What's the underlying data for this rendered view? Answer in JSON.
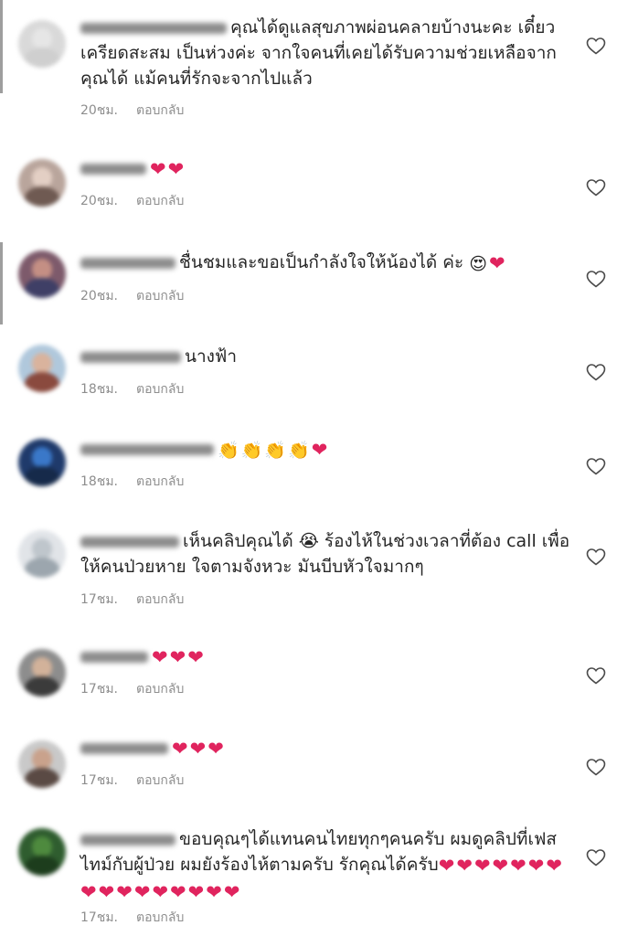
{
  "comments": [
    {
      "text": "คุณได้ดูแลสุขภาพผ่อนคลายบ้างนะคะ เดี๋ยวเครียดสะสม เป็นห่วงค่ะ จากใจคนที่เคยได้รับความช่วยเหลือจากคุณได้ แม้คนที่รักจะจากไปแล้ว",
      "emoji": "",
      "time": "20ชม.",
      "reply": "ตอบกลับ",
      "avatar_colors": [
        "#d9d9d9",
        "#e6e6e6",
        "#cfcfcf"
      ]
    },
    {
      "text": "",
      "emoji": "❤❤",
      "time": "20ชม.",
      "reply": "ตอบกลับ",
      "avatar_colors": [
        "#b9a59c",
        "#e3cfc4",
        "#6f5a52"
      ]
    },
    {
      "text": "ชื่นชมและขอเป็นกำลังใจให้น้องได้ ค่ะ",
      "emoji": "😍❤",
      "time": "20ชม.",
      "reply": "ตอบกลับ",
      "avatar_colors": [
        "#7d5a6b",
        "#c48f84",
        "#3f3f66"
      ]
    },
    {
      "text": "นางฟ้า",
      "emoji": "",
      "time": "18ชม.",
      "reply": "ตอบกลับ",
      "avatar_colors": [
        "#b0c8dc",
        "#d9b39d",
        "#8a4a3e"
      ]
    },
    {
      "text": "",
      "emoji": "👏👏👏👏❤",
      "time": "18ชม.",
      "reply": "ตอบกลับ",
      "avatar_colors": [
        "#1f3a6b",
        "#3a78c9",
        "#162a4a"
      ]
    },
    {
      "text": "เห็นคลิปคุณได้ 😭 ร้องไห้ในช่วงเวลาที่ต้อง call เพื่อให้คนป่วยหาย ใจตามจังหวะ มันบีบหัวใจมากๆ",
      "emoji": "",
      "time": "17ชม.",
      "reply": "ตอบกลับ",
      "avatar_colors": [
        "#e1e4e8",
        "#bfc6cc",
        "#9ca6ae"
      ]
    },
    {
      "text": "",
      "emoji": "❤❤❤",
      "time": "17ชม.",
      "reply": "ตอบกลับ",
      "avatar_colors": [
        "#8d8d8d",
        "#d2b29a",
        "#3b3b3b"
      ]
    },
    {
      "text": "",
      "emoji": "❤❤❤",
      "time": "17ชม.",
      "reply": "ตอบกลับ",
      "avatar_colors": [
        "#c9c9c9",
        "#c9a28c",
        "#5a4a44"
      ]
    },
    {
      "text": "ขอบคุณๆได้แทนคนไทยทุกๆคนครับ ผมดูคลิปที่เฟสไทม์กับผู้ป่วย ผมยังร้องไห้ตามครับ รักคุณได้ครับ",
      "emoji": "❤❤❤❤❤❤❤❤❤❤❤❤❤❤❤❤",
      "time": "17ชม.",
      "reply": "ตอบกลับ",
      "avatar_colors": [
        "#2f5d2f",
        "#4e8a3e",
        "#1d3d1d"
      ]
    }
  ]
}
